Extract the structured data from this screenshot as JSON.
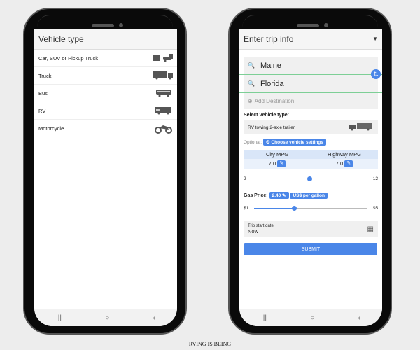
{
  "left_screen": {
    "title": "Vehicle type",
    "items": [
      {
        "label": "Car, SUV or Pickup Truck",
        "icon": "car-icon"
      },
      {
        "label": "Truck",
        "icon": "truck-icon"
      },
      {
        "label": "Bus",
        "icon": "bus-icon"
      },
      {
        "label": "RV",
        "icon": "rv-icon"
      },
      {
        "label": "Motorcycle",
        "icon": "motorcycle-icon"
      }
    ]
  },
  "right_screen": {
    "title": "Enter trip info",
    "origin": "Maine",
    "destination": "Florida",
    "add_destination": "Add Destination",
    "select_vehicle_label": "Select vehicle type:",
    "vehicle_value": "RV towing 2-axle trailer",
    "optional_label": "Optional:",
    "vehicle_settings_button": "Choose vehicle settings",
    "mpg": {
      "city_label": "City MPG",
      "highway_label": "Highway MPG",
      "city_value": "7.0",
      "highway_value": "7.0"
    },
    "mpg_slider": {
      "min": "2",
      "max": "12",
      "value": 7
    },
    "gas_label": "Gas Price:",
    "gas_value": "2.40",
    "gas_unit": "US$ per gallon",
    "gas_slider": {
      "min": "$1",
      "max": "$5",
      "value": 2.4
    },
    "date_label": "Trip start date",
    "date_value": "Now",
    "submit": "SUBMIT"
  },
  "nav": {
    "recent": "|||",
    "home": "○",
    "back": "‹"
  },
  "watermark": "RVING IS BEING"
}
